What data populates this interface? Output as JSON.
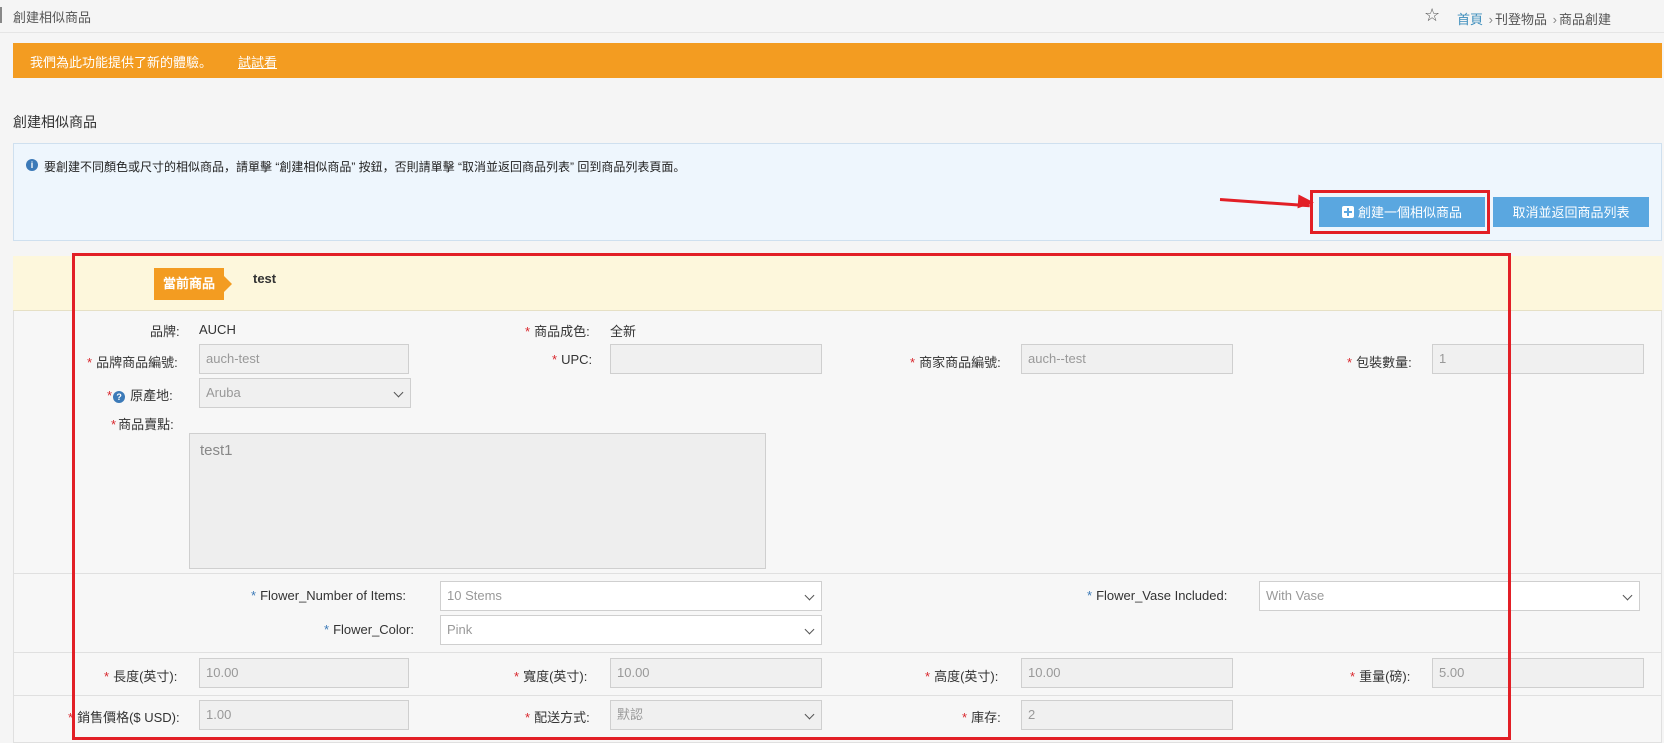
{
  "header": {
    "title": "創建相似商品",
    "breadcrumb": {
      "home": "首頁",
      "sep1": "›",
      "item1": "刊登物品",
      "sep2": "›",
      "item2": "商品創建"
    }
  },
  "banner": {
    "text": "我們為此功能提供了新的體驗。",
    "try_label": "試試看",
    "color": "#f39c21"
  },
  "section_title": "創建相似商品",
  "info": {
    "text": "要創建不同顏色或尺寸的相似商品，請單擊 “創建相似商品” 按鈕，否則請單擊 “取消並返回商品列表” 回到商品列表頁面。",
    "create_button": "創建一個相似商品",
    "cancel_button": "取消並返回商品列表"
  },
  "current": {
    "tag": "當前商品",
    "name": "test"
  },
  "fields": {
    "brand_label": "品牌:",
    "brand_value": "AUCH",
    "condition_label": "商品成色:",
    "condition_value": "全新",
    "brand_sku_label": "品牌商品編號:",
    "brand_sku_value": "auch-test",
    "upc_label": "UPC:",
    "upc_value": "",
    "merchant_sku_label": "商家商品編號:",
    "merchant_sku_value": "auch--test",
    "pack_qty_label": "包裝數量:",
    "pack_qty_value": "1",
    "origin_label": "原產地:",
    "origin_value": "Aruba",
    "selling_points_label": "商品賣點:",
    "selling_points_value": "test1",
    "flower_items_label": "Flower_Number of Items:",
    "flower_items_value": "10 Stems",
    "flower_vase_label": "Flower_Vase Included:",
    "flower_vase_value": "With Vase",
    "flower_color_label": "Flower_Color:",
    "flower_color_value": "Pink",
    "length_label": "長度(英寸):",
    "length_value": "10.00",
    "width_label": "寬度(英寸):",
    "width_value": "10.00",
    "height_label": "高度(英寸):",
    "height_value": "10.00",
    "weight_label": "重量(磅):",
    "weight_value": "5.00",
    "price_label": "銷售價格($ USD):",
    "price_value": "1.00",
    "shipping_label": "配送方式:",
    "shipping_value": "默認",
    "stock_label": "庫存:",
    "stock_value": "2"
  },
  "colors": {
    "accent": "#5aa7e0",
    "highlight": "#e21f26",
    "required": "#d9262c"
  }
}
